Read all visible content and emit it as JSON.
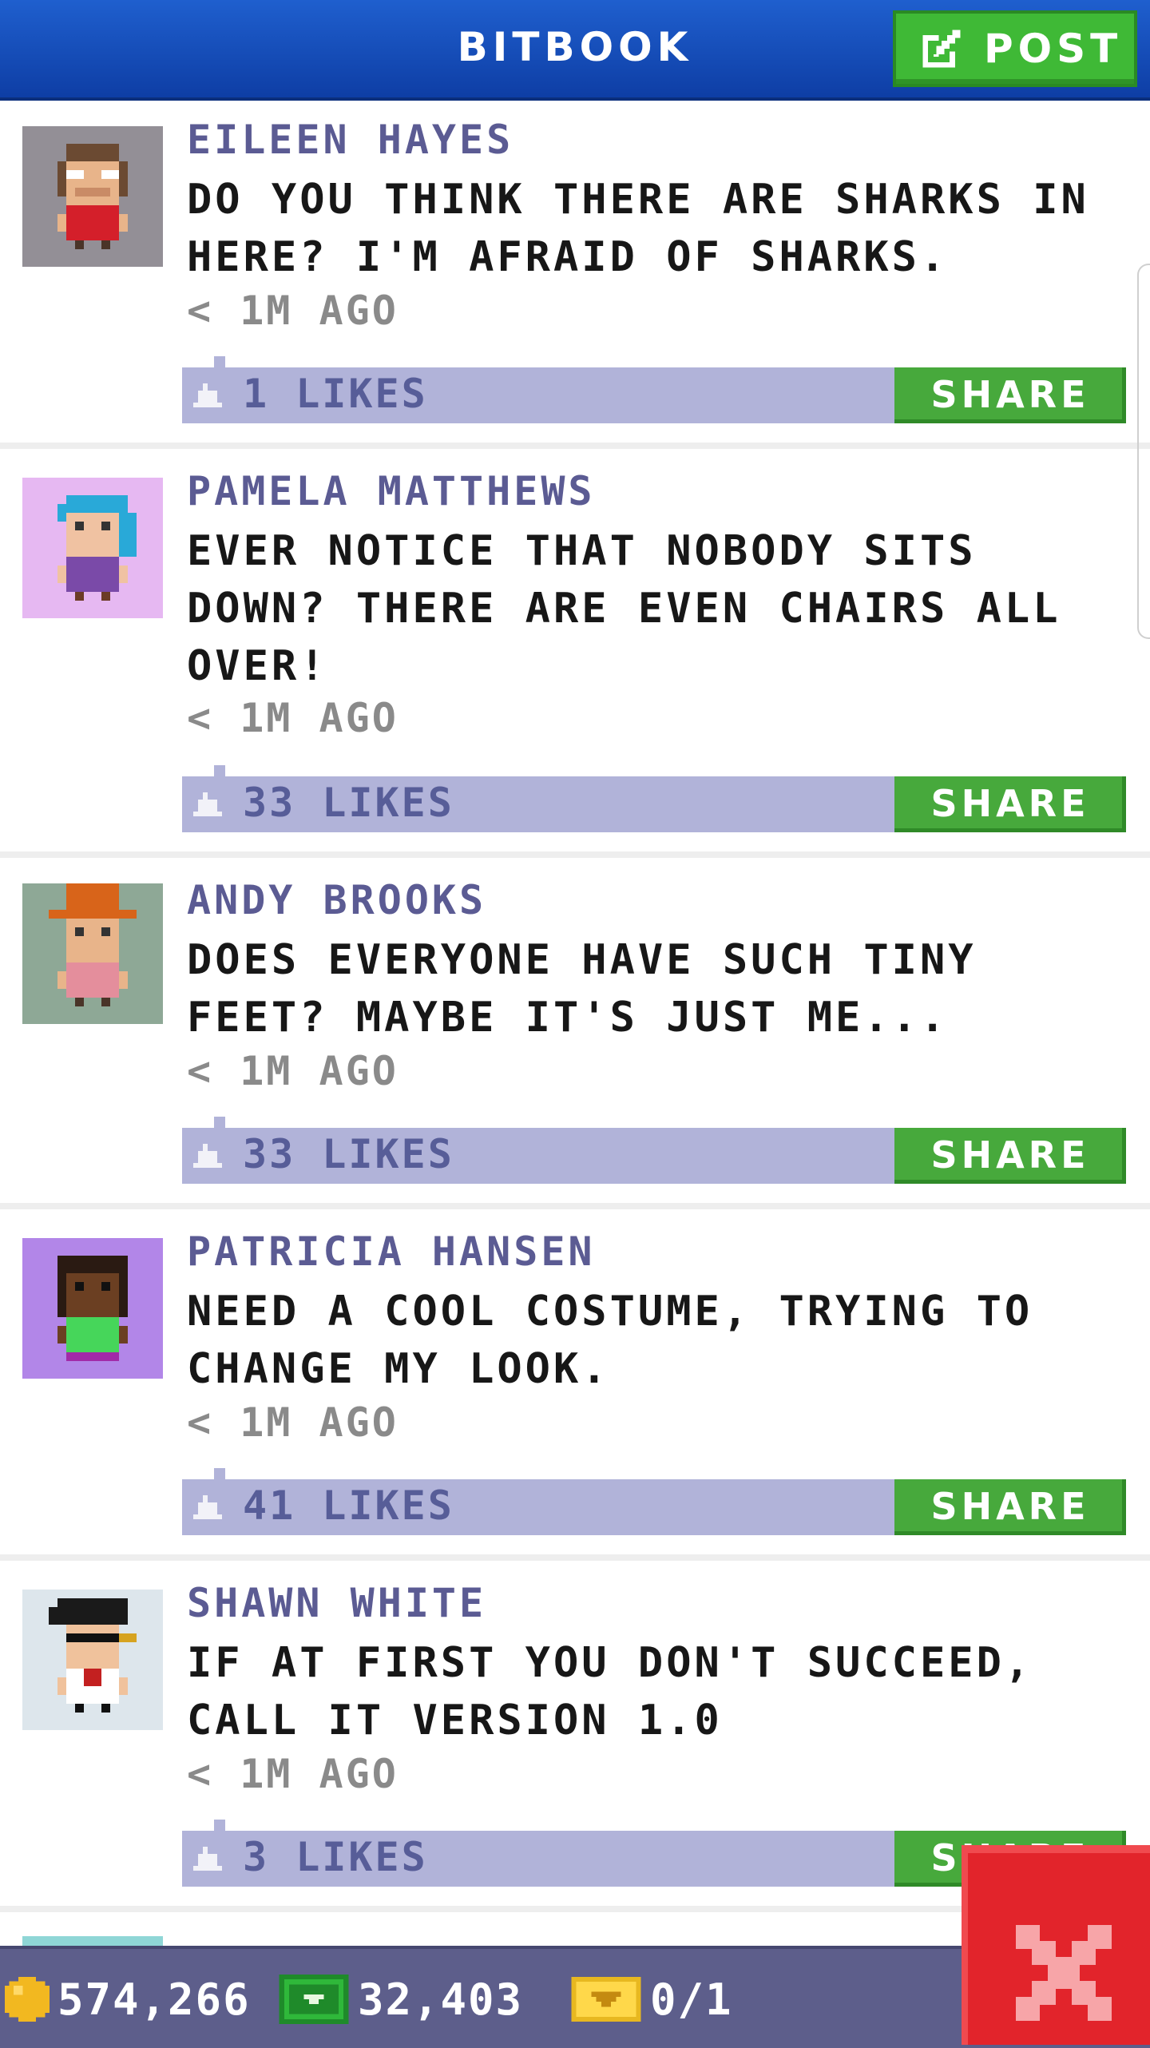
{
  "header": {
    "title": "BITBOOK",
    "post_label": "POST"
  },
  "posts": [
    {
      "author": "EILEEN HAYES",
      "message": "DO YOU THINK THERE ARE SHARKS IN HERE? I'M AFRAID OF SHARKS.",
      "time": "< 1M AGO",
      "likes": "1 LIKES",
      "share": "SHARE"
    },
    {
      "author": "PAMELA MATTHEWS",
      "message": "EVER NOTICE THAT NOBODY SITS DOWN? THERE ARE EVEN CHAIRS ALL OVER!",
      "time": "< 1M AGO",
      "likes": "33 LIKES",
      "share": "SHARE"
    },
    {
      "author": "ANDY BROOKS",
      "message": "DOES EVERYONE HAVE SUCH TINY FEET? MAYBE IT'S JUST ME...",
      "time": "< 1M AGO",
      "likes": "33 LIKES",
      "share": "SHARE"
    },
    {
      "author": "PATRICIA HANSEN",
      "message": "NEED A COOL COSTUME, TRYING TO CHANGE MY LOOK.",
      "time": "< 1M AGO",
      "likes": "41 LIKES",
      "share": "SHARE"
    },
    {
      "author": "SHAWN WHITE",
      "message": "IF AT FIRST YOU DON'T SUCCEED, CALL IT VERSION 1.0",
      "time": "< 1M AGO",
      "likes": "3 LIKES",
      "share": "SHARE"
    }
  ],
  "bottom_bar": {
    "coins": "574,266",
    "bux": "32,403",
    "tickets": "0/1"
  },
  "colors": {
    "header": "#1450b8",
    "share_green": "#47a93c",
    "likes_bar": "#b1b3d9",
    "author_purple": "#5b5b93",
    "close_red": "#e2242b"
  }
}
